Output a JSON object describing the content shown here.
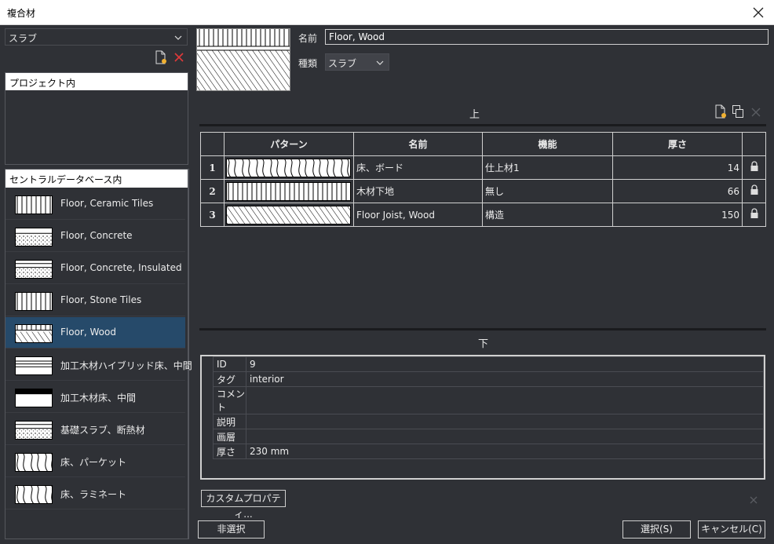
{
  "window": {
    "title": "複合材"
  },
  "left": {
    "type_select": "スラブ",
    "project_header": "プロジェクト内",
    "central_header": "セントラルデータベース内",
    "materials": [
      {
        "label": "Floor, Ceramic Tiles",
        "pattern": "vertical"
      },
      {
        "label": "Floor, Concrete",
        "pattern": "concrete"
      },
      {
        "label": "Floor, Concrete, Insulated",
        "pattern": "concrete-insulated"
      },
      {
        "label": "Floor, Stone Tiles",
        "pattern": "vertical"
      },
      {
        "label": "Floor, Wood",
        "pattern": "wood-composite",
        "selected": true
      },
      {
        "label": "加工木材ハイブリッド床、中間",
        "pattern": "hybrid"
      },
      {
        "label": "加工木材床、中間",
        "pattern": "solid-top"
      },
      {
        "label": "基礎スラブ、断熱材",
        "pattern": "concrete-insulated"
      },
      {
        "label": "床、パーケット",
        "pattern": "parquet"
      },
      {
        "label": "床、ラミネート",
        "pattern": "parquet"
      }
    ]
  },
  "details": {
    "name_label": "名前",
    "name_value": "Floor, Wood",
    "kind_label": "種類",
    "kind_value": "スラブ",
    "top_label": "上",
    "bottom_label": "下"
  },
  "layers": {
    "headers": [
      "パターン",
      "名前",
      "機能",
      "厚さ"
    ],
    "rows": [
      {
        "num": "1",
        "name": "床、ボード",
        "function": "仕上材1",
        "thickness": "14",
        "pattern": "wood"
      },
      {
        "num": "2",
        "name": "木材下地",
        "function": "無し",
        "thickness": "66",
        "pattern": "vertical"
      },
      {
        "num": "3",
        "name": "Floor Joist, Wood",
        "function": "構造",
        "thickness": "150",
        "pattern": "diagonal"
      }
    ]
  },
  "properties": [
    {
      "key": "ID",
      "value": "9"
    },
    {
      "key": "タグ",
      "value": "interior"
    },
    {
      "key": "コメント",
      "value": ""
    },
    {
      "key": "説明",
      "value": ""
    },
    {
      "key": "画層",
      "value": ""
    },
    {
      "key": "厚さ",
      "value": "230 mm"
    }
  ],
  "buttons": {
    "custom_props": "カスタムプロパティ...",
    "deselect": "非選択",
    "select": "選択(S)",
    "cancel": "キャンセル(C)"
  }
}
